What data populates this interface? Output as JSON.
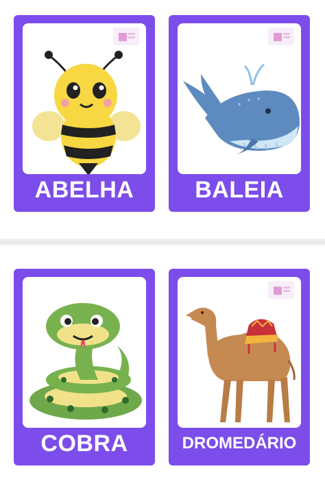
{
  "cards": [
    {
      "label": "ABELHA"
    },
    {
      "label": "BALEIA"
    },
    {
      "label": "COBRA"
    },
    {
      "label": "DROMEDÁRIO"
    }
  ],
  "colors": {
    "card_bg": "#7c4dea",
    "picture_bg": "#ffffff",
    "label_text": "#ffffff"
  },
  "icons": [
    "bee-icon",
    "whale-icon",
    "snake-icon",
    "camel-icon",
    "logo-watermark-icon"
  ]
}
